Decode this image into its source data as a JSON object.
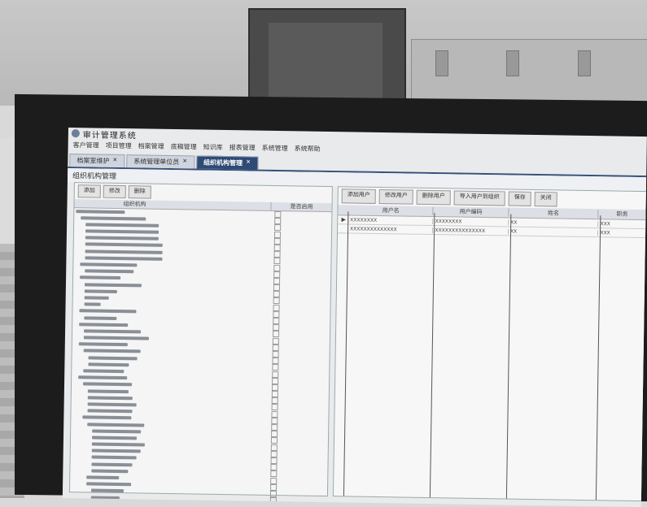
{
  "window": {
    "title": "审计管理系统",
    "menu": [
      "客户管理",
      "项目管理",
      "档案管理",
      "底稿管理",
      "知识库",
      "报表管理",
      "系统管理",
      "系统帮助"
    ]
  },
  "tabs": [
    {
      "label": "档案室维护",
      "active": false
    },
    {
      "label": "系统管理单位员",
      "active": false
    },
    {
      "label": "组织机构管理",
      "active": true
    }
  ],
  "left_panel": {
    "title": "组织机构管理",
    "buttons": [
      "添加",
      "修改",
      "删除"
    ],
    "columns": [
      "组织机构",
      "是否启用"
    ]
  },
  "right_panel": {
    "buttons": [
      "添加用户",
      "修改用户",
      "删除用户",
      "导入用户到组织",
      "保存",
      "关闭"
    ],
    "columns": [
      "用户名",
      "用户编码",
      "姓名",
      "职务"
    ],
    "rows": [
      {
        "name": "XXXXXXXX",
        "code": "XXXXXXXX",
        "person": "XX",
        "role": "XXX"
      },
      {
        "name": "XXXXXXXXXXXXXX",
        "code": "XXXXXXXXXXXXXXX",
        "person": "XX",
        "role": "XXX"
      }
    ]
  },
  "colors": {
    "accent": "#2e4a75",
    "screen_bg": "#e9eaec"
  }
}
